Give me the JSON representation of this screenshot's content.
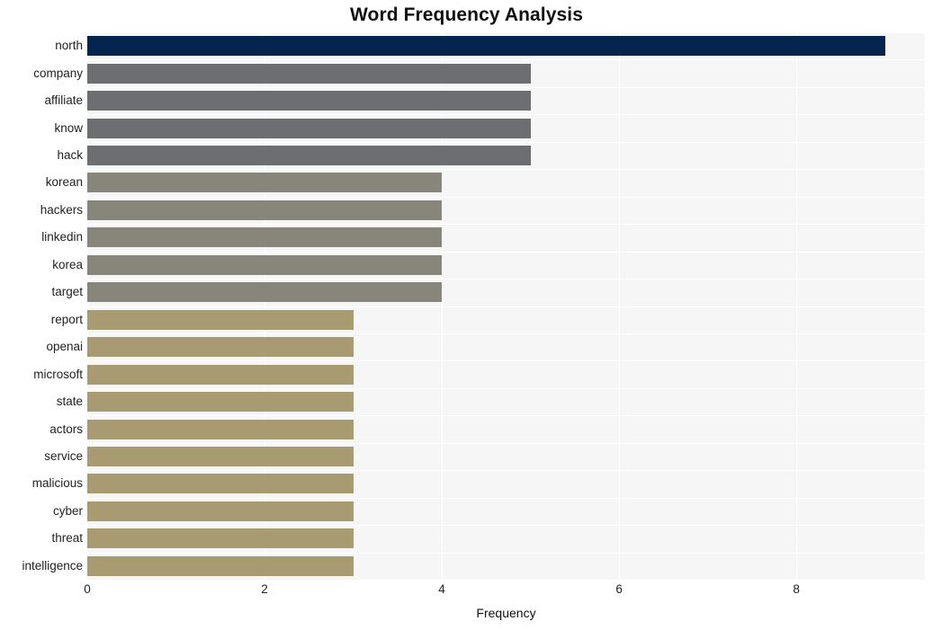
{
  "chart_data": {
    "type": "bar",
    "orientation": "horizontal",
    "title": "Word Frequency Analysis",
    "xlabel": "Frequency",
    "ylabel": "",
    "xlim": [
      0,
      9.45
    ],
    "xticks": [
      0,
      2,
      4,
      6,
      8
    ],
    "xticklabels": [
      "0",
      "2",
      "4",
      "6",
      "8"
    ],
    "grid": true,
    "grid_axis": "x",
    "legend": false,
    "categories": [
      "north",
      "company",
      "affiliate",
      "know",
      "hack",
      "korean",
      "hackers",
      "linkedin",
      "korea",
      "target",
      "report",
      "openai",
      "microsoft",
      "state",
      "actors",
      "service",
      "malicious",
      "cyber",
      "threat",
      "intelligence"
    ],
    "values": [
      9,
      5,
      5,
      5,
      5,
      4,
      4,
      4,
      4,
      4,
      3,
      3,
      3,
      3,
      3,
      3,
      3,
      3,
      3,
      3
    ],
    "bar_colors": [
      "#04254e",
      "#6d6e71",
      "#6d6e71",
      "#6d6e71",
      "#6d6e71",
      "#88857a",
      "#88857a",
      "#88857a",
      "#88857a",
      "#88857a",
      "#a89b72",
      "#a89b72",
      "#a89b72",
      "#a89b72",
      "#a89b72",
      "#a89b72",
      "#a89b72",
      "#a89b72",
      "#a89b72",
      "#a89b72"
    ]
  },
  "style": {
    "plot_background": "#f6f6f7",
    "figure_background": "#ffffff",
    "gridline_color": "#ffffff",
    "tick_label_color": "#222222",
    "title_color": "#111111"
  }
}
